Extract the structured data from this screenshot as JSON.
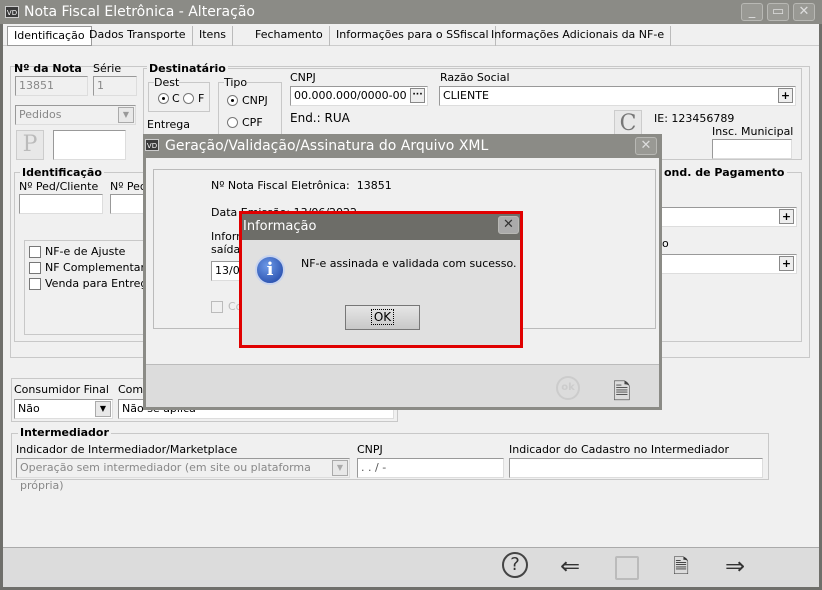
{
  "window": {
    "title": "Nota Fiscal Eletrônica - Alteração",
    "logo": "VD"
  },
  "tabs": [
    "Identificação",
    "Dados Transporte",
    "Itens",
    "Fechamento",
    "Informações para o SSfiscal",
    "Informações Adicionais da NF-e"
  ],
  "nota": {
    "numero_label": "Nº da Nota",
    "numero": "13851",
    "serie_label": "Série",
    "serie": "1",
    "tipo_select": "Pedidos",
    "p_button": "P"
  },
  "destinatario": {
    "label": "Destinatário",
    "dest_label": "Dest",
    "dest_c": "C",
    "dest_f": "F",
    "tipo_label": "Tipo",
    "cnpj_opt": "CNPJ",
    "cpf_opt": "CPF",
    "entrega_label": "Entrega",
    "cnpj_label": "CNPJ",
    "cnpj": "00.000.000/0000-00",
    "razao_label": "Razão Social",
    "razao": "CLIENTE",
    "endereco": "End.: RUA",
    "c_button": "C",
    "ie": "IE: 123456789",
    "insc_municipal_label": "Insc. Municipal"
  },
  "identificacao": {
    "label": "Identificação",
    "ped_cliente_label": "Nº Ped/Cliente",
    "ped_label": "Nº Ped",
    "checkboxes": [
      "NF-e de Ajuste",
      "NF Complementar",
      "Venda para Entrega"
    ]
  },
  "pagamento": {
    "label": "ond. de Pagamento",
    "sub_label": "o"
  },
  "consumidor": {
    "label": "Consumidor Final",
    "value": "Não",
    "comp_label": "Comp",
    "comp_value": "Não se aplica"
  },
  "intermediador": {
    "label": "Intermediador",
    "indicador_label": "Indicador de Intermediador/Marketplace",
    "indicador_value": "Operação sem intermediador (em site ou plataforma própria)",
    "cnpj_label": "CNPJ",
    "cnpj_value": " .  .  /  -",
    "cadastro_label": "Indicador do Cadastro no Intermediador"
  },
  "xml_dialog": {
    "title": "Geração/Validação/Assinatura do Arquivo XML",
    "nf_label": "Nº Nota Fiscal Eletrônica:",
    "nf_value": "13851",
    "data_label": "Data Emissão: 13/06/2022",
    "inform_label": "Inform",
    "saida_label": "saída d",
    "date_value": "13/06",
    "check_label": "Co",
    "ok_icon": "ok"
  },
  "info_dialog": {
    "title": "Informação",
    "message": "NF-e assinada e validada com sucesso.",
    "ok": "OK",
    "icon": "info-icon"
  },
  "footer": {
    "icons": [
      "help-icon",
      "back-arrow-icon",
      "save-icon",
      "cancel-document-icon",
      "forward-arrow-icon"
    ]
  }
}
